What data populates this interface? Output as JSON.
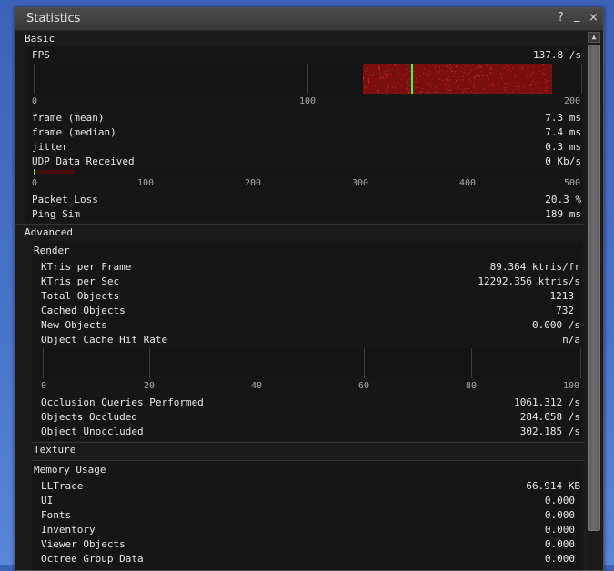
{
  "window": {
    "title": "Statistics",
    "help_label": "?",
    "minimize_label": "_",
    "close_label": "×"
  },
  "scroll": {
    "up_glyph": "▲"
  },
  "basic": {
    "header": "Basic",
    "fps": {
      "label": "FPS",
      "value": "137.8 /s"
    },
    "fps_graph": {
      "ticks": [
        "0",
        "100",
        "200"
      ],
      "range_min": 120,
      "range_max": 189,
      "current": 137.8,
      "fill_color": "#7a0f0f",
      "marker_color": "#39ff39"
    },
    "frame_mean": {
      "label": "frame (mean)",
      "value": "7.3 ms"
    },
    "frame_median": {
      "label": "frame (median)",
      "value": "7.4 ms"
    },
    "jitter": {
      "label": "jitter",
      "value": "0.3 ms"
    },
    "udp": {
      "label": "UDP Data Received",
      "value": "0 Kb/s"
    },
    "udp_graph": {
      "ticks": [
        "0",
        "100",
        "200",
        "300",
        "400",
        "500"
      ]
    },
    "packet_loss": {
      "label": "Packet Loss",
      "value": "20.3 %"
    },
    "ping_sim": {
      "label": "Ping Sim",
      "value": "189 ms"
    }
  },
  "advanced": {
    "header": "Advanced",
    "render": {
      "header": "Render",
      "ktris_frame": {
        "label": "KTris per Frame",
        "value": "89.364 ktris/fr"
      },
      "ktris_sec": {
        "label": "KTris per Sec",
        "value": "12292.356 ktris/s"
      },
      "total_objects": {
        "label": "Total Objects",
        "value": "1213"
      },
      "cached_objects": {
        "label": "Cached Objects",
        "value": "732"
      },
      "new_objects": {
        "label": "New Objects",
        "value": "0.000 /s"
      },
      "cache_hit": {
        "label": "Object Cache Hit Rate",
        "value": "n/a"
      },
      "cache_graph": {
        "ticks": [
          "0",
          "20",
          "40",
          "60",
          "80",
          "100"
        ]
      },
      "occlusion": {
        "label": "Occlusion Queries Performed",
        "value": "1061.312 /s"
      },
      "occluded": {
        "label": "Objects Occluded",
        "value": "284.058 /s"
      },
      "unoccluded": {
        "label": "Object Unoccluded",
        "value": "302.185 /s"
      }
    },
    "texture": {
      "header": "Texture"
    },
    "memory": {
      "header": "Memory Usage",
      "lltrace": {
        "label": "LLTrace",
        "value": "66.914 KB"
      },
      "ui": {
        "label": "UI",
        "value": "0.000"
      },
      "fonts": {
        "label": "Fonts",
        "value": "0.000"
      },
      "inventory": {
        "label": "Inventory",
        "value": "0.000"
      },
      "viewer_objects": {
        "label": "Viewer Objects",
        "value": "0.000"
      },
      "octree": {
        "label": "Octree Group Data",
        "value": "0.000"
      }
    }
  }
}
